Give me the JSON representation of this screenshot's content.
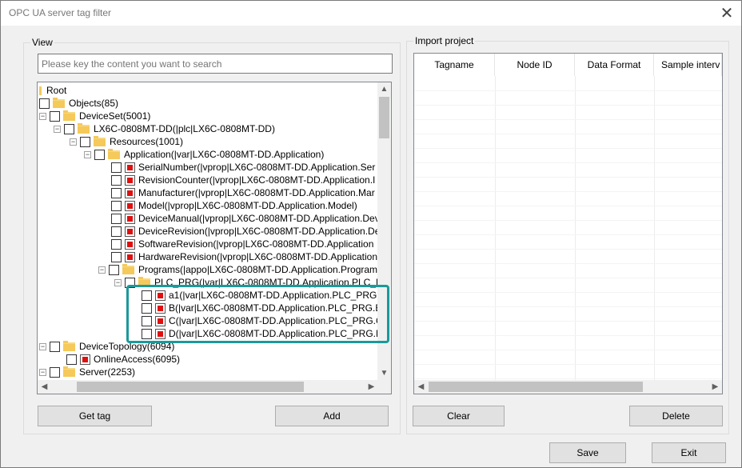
{
  "window": {
    "title": "OPC UA server tag filter",
    "close_glyph": "✕"
  },
  "view_group": {
    "label": "View",
    "search_placeholder": "Please key the content you want to search",
    "tree": [
      {
        "label": "Root",
        "kind": "root"
      },
      {
        "label": "Objects(85)",
        "kind": "folder"
      },
      {
        "label": "DeviceSet(5001)",
        "kind": "folder"
      },
      {
        "label": "LX6C-0808MT-DD(|plc|LX6C-0808MT-DD)",
        "kind": "folder"
      },
      {
        "label": "Resources(1001)",
        "kind": "folder"
      },
      {
        "label": "Application(|var|LX6C-0808MT-DD.Application)",
        "kind": "folder"
      },
      {
        "label": "SerialNumber(|vprop|LX6C-0808MT-DD.Application.Ser",
        "kind": "tag"
      },
      {
        "label": "RevisionCounter(|vprop|LX6C-0808MT-DD.Application.I",
        "kind": "tag"
      },
      {
        "label": "Manufacturer(|vprop|LX6C-0808MT-DD.Application.Mar",
        "kind": "tag"
      },
      {
        "label": "Model(|vprop|LX6C-0808MT-DD.Application.Model)",
        "kind": "tag"
      },
      {
        "label": "DeviceManual(|vprop|LX6C-0808MT-DD.Application.Dev",
        "kind": "tag"
      },
      {
        "label": "DeviceRevision(|vprop|LX6C-0808MT-DD.Application.De",
        "kind": "tag"
      },
      {
        "label": "SoftwareRevision(|vprop|LX6C-0808MT-DD.Application",
        "kind": "tag"
      },
      {
        "label": "HardwareRevision(|vprop|LX6C-0808MT-DD.Application",
        "kind": "tag"
      },
      {
        "label": "Programs(|appo|LX6C-0808MT-DD.Application.Program",
        "kind": "folder"
      },
      {
        "label": "PLC_PRG(|var|LX6C-0808MT-DD.Application.PLC_PRG",
        "kind": "folder"
      },
      {
        "label": "a1(|var|LX6C-0808MT-DD.Application.PLC_PRG.",
        "kind": "tag"
      },
      {
        "label": "B(|var|LX6C-0808MT-DD.Application.PLC_PRG.B",
        "kind": "tag"
      },
      {
        "label": "C(|var|LX6C-0808MT-DD.Application.PLC_PRG.C",
        "kind": "tag"
      },
      {
        "label": "D(|var|LX6C-0808MT-DD.Application.PLC_PRG.D",
        "kind": "tag"
      },
      {
        "label": "DeviceTopology(6094)",
        "kind": "folder"
      },
      {
        "label": "OnlineAccess(6095)",
        "kind": "tag"
      },
      {
        "label": "Server(2253)",
        "kind": "folder"
      }
    ],
    "get_tag_button": "Get tag",
    "add_button": "Add"
  },
  "import_group": {
    "label": "Import project",
    "columns": [
      "Tagname",
      "Node ID",
      "Data Format",
      "Sample interv"
    ],
    "clear_button": "Clear",
    "delete_button": "Delete"
  },
  "footer": {
    "save_button": "Save",
    "exit_button": "Exit"
  },
  "colors": {
    "highlight": "#1a9a9a",
    "tag_icon": "#e01010",
    "folder": "#f5c95a"
  },
  "icons": {
    "folder": "folder-icon",
    "tag": "tag-variable-icon",
    "scroll_up": "▲",
    "scroll_down": "▼",
    "scroll_left": "◀",
    "scroll_right": "▶"
  }
}
